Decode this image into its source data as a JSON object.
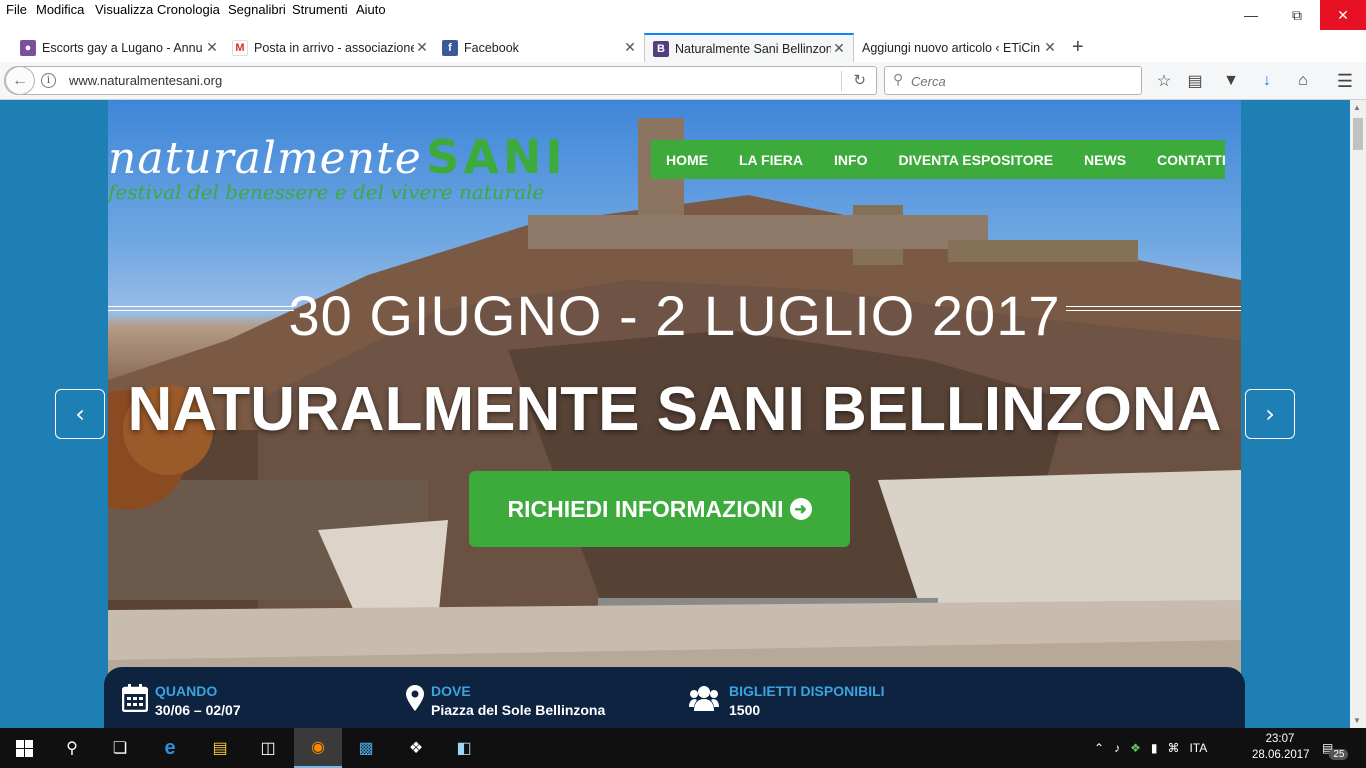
{
  "menubar": {
    "items": [
      "File",
      "Modifica",
      "Visualizza",
      "Cronologia",
      "Segnalibri",
      "Strumenti",
      "Aiuto"
    ],
    "window_controls": [
      "minimize-icon",
      "restore-icon",
      "close-icon"
    ]
  },
  "tabs": [
    {
      "title": "Escorts gay a Lugano - Annu",
      "icon": "escorts-site-icon",
      "active": false
    },
    {
      "title": "Posta in arrivo - associazione",
      "icon": "gmail-icon",
      "active": false
    },
    {
      "title": "Facebook",
      "icon": "facebook-icon",
      "active": false
    },
    {
      "title": "Naturalmente Sani Bellinzon",
      "icon": "bootstrap-icon",
      "active": true
    },
    {
      "title": "Aggiungi nuovo articolo ‹ ETiCin",
      "icon": "wordpress-icon",
      "active": false
    }
  ],
  "navbar": {
    "url": "www.naturalmentesani.org",
    "search_placeholder": "Cerca"
  },
  "site": {
    "logo_word": "naturalmente",
    "logo_accent": "SANI",
    "logo_tagline": "festival del benessere e del vivere naturale",
    "nav": [
      "HOME",
      "LA FIERA",
      "INFO",
      "DIVENTA ESPOSITORE",
      "NEWS",
      "CONTATTI"
    ],
    "dates": "30 GIUGNO - 2 LUGLIO 2017",
    "headline": "NATURALMENTE SANI BELLINZONA",
    "cta": "RICHIEDI INFORMAZIONI",
    "info": {
      "quando_label": "QUANDO",
      "quando_value": "30/06 – 02/07",
      "dove_label": "DOVE",
      "dove_value": "Piazza del Sole Bellinzona",
      "biglietti_label": "BIGLIETTI DISPONIBILI",
      "biglietti_value": "1500"
    }
  },
  "colors": {
    "brand_green": "#3cab3c",
    "page_blue": "#1e7fb4",
    "info_bar": "#0e2340",
    "info_label": "#3aa3e0"
  },
  "taskbar": {
    "language": "ITA",
    "time": "23:07",
    "date": "28.06.2017",
    "notifications": "25"
  }
}
